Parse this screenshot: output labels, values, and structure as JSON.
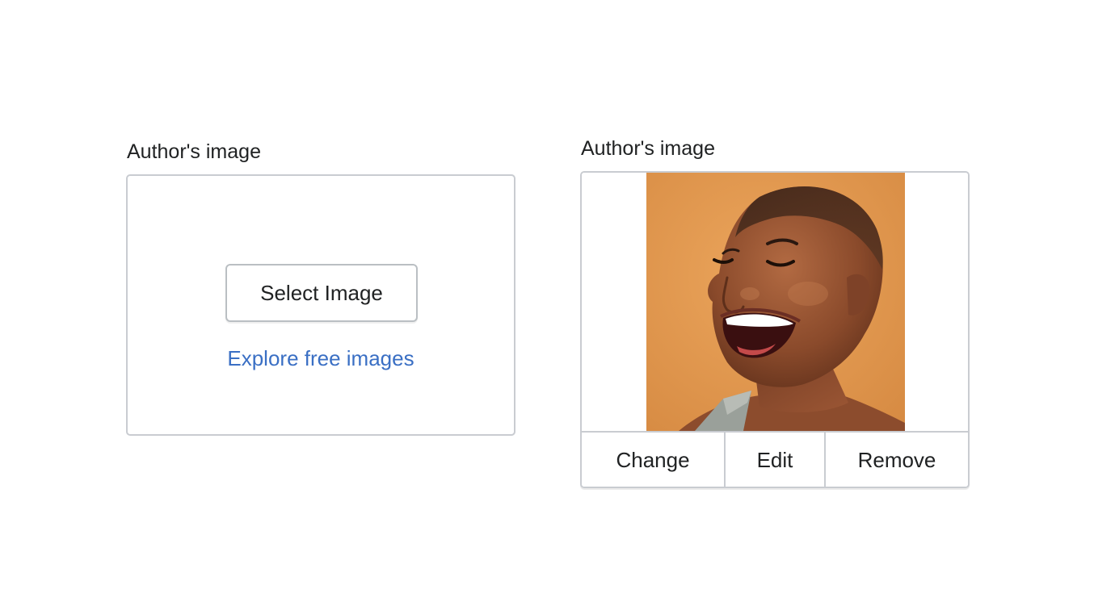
{
  "empty_uploader": {
    "label": "Author's image",
    "select_button": "Select Image",
    "explore_link": "Explore free images"
  },
  "filled_uploader": {
    "label": "Author's image",
    "image_icon": "author-portrait-photo",
    "actions": {
      "change": "Change",
      "edit": "Edit",
      "remove": "Remove"
    }
  },
  "colors": {
    "link": "#3a6fc4",
    "border": "#c9ccd1",
    "text": "#202223",
    "photo_background": "#e09a52"
  }
}
